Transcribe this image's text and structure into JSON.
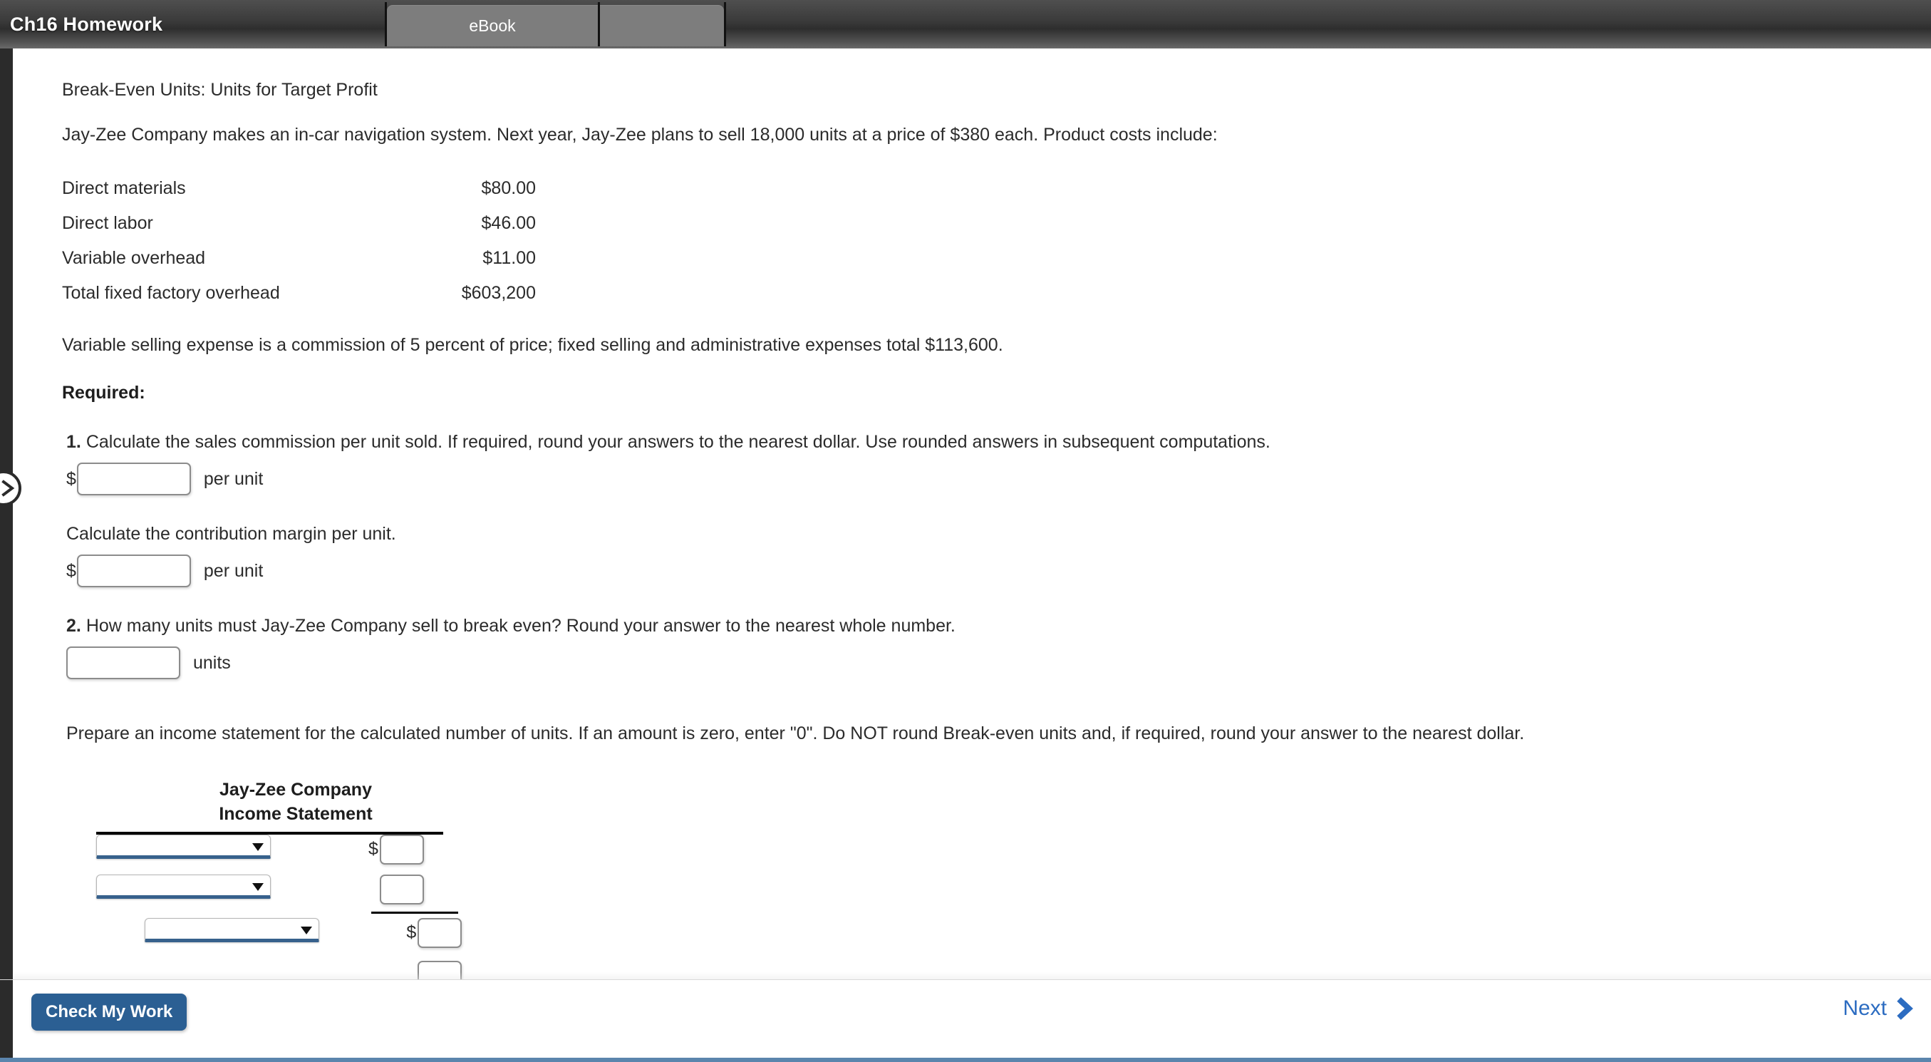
{
  "header": {
    "title": "Ch16 Homework",
    "tabs": [
      {
        "label": "eBook",
        "name": "tab-ebook"
      },
      {
        "label": "",
        "name": "tab-blank"
      }
    ]
  },
  "question": {
    "topic": "Break-Even Units: Units for Target Profit",
    "intro": "Jay-Zee Company makes an in-car navigation system. Next year, Jay-Zee plans to sell 18,000 units at a price of $380 each. Product costs include:",
    "cost_table": {
      "rows": [
        {
          "label": "Direct materials",
          "amount": "$80.00"
        },
        {
          "label": "Direct labor",
          "amount": "$46.00"
        },
        {
          "label": "Variable overhead",
          "amount": "$11.00"
        },
        {
          "label": "Total fixed factory overhead",
          "amount": "$603,200"
        }
      ]
    },
    "selling_expense_note": "Variable selling expense is a commission of 5 percent of price; fixed selling and administrative expenses total $113,600.",
    "required_label": "Required:",
    "part1": {
      "number": "1.",
      "text": "Calculate the sales commission per unit sold. If required, round your answers to the nearest dollar. Use rounded answers in subsequent computations.",
      "dollar_sign": "$",
      "input_value": "",
      "unit_label": "per unit",
      "followup_text": "Calculate the contribution margin per unit.",
      "followup_dollar_sign": "$",
      "followup_input_value": "",
      "followup_unit_label": "per unit"
    },
    "part2": {
      "number": "2.",
      "text": "How many units must Jay-Zee Company sell to break even? Round your answer to the nearest whole number.",
      "input_value": "",
      "unit_label": "units"
    },
    "prepare_text": "Prepare an income statement for the calculated number of units. If an amount is zero, enter \"0\". Do NOT round Break-even units and, if required, round your answer to the nearest dollar."
  },
  "income_statement": {
    "company": "Jay-Zee Company",
    "title": "Income Statement",
    "rows": [
      {
        "select_value": "",
        "dollar": "$",
        "amount_value": "",
        "indent": 0,
        "rule_below": false
      },
      {
        "select_value": "",
        "dollar": "",
        "amount_value": "",
        "indent": 0,
        "rule_below": true
      },
      {
        "select_value": "",
        "dollar": "$",
        "amount_value": "",
        "indent": 1,
        "rule_below": false
      },
      {
        "select_value": "",
        "dollar": "",
        "amount_value": "",
        "indent": 1,
        "rule_below": false
      }
    ]
  },
  "footer": {
    "check_label": "Check My Work",
    "next_label": "Next"
  },
  "icons": {
    "left_expand": "chevron-right-icon",
    "next_chevron": "chevron-right-icon",
    "select_caret": "chevron-down-icon"
  },
  "colors": {
    "accent_blue": "#2b5f93",
    "link_blue": "#2c6cc1",
    "select_underline": "#37618c",
    "topbar_dark": "#3b3b3b",
    "tab_gray": "#7d7d7d",
    "rail_dark": "#2b2b2b",
    "page_bottom": "#5b85ad"
  }
}
